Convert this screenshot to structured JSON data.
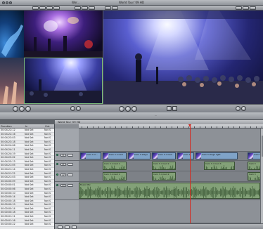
{
  "viewer": {
    "title": "Wor..."
  },
  "canvas": {
    "title": "World Tour '09 HD",
    "status": "..."
  },
  "timeline": {
    "tab_label": "World Tour '09 HD"
  },
  "browser": {
    "columns": [
      "Duration",
      "In",
      "Out"
    ],
    "rows": [
      {
        "duration": "00:04:22:12",
        "in": "Not Set",
        "out": "Not S"
      },
      {
        "duration": "00:04:22:16",
        "in": "Not Set",
        "out": "Not S"
      },
      {
        "duration": "00:04:23:03",
        "in": "Not Set",
        "out": "Not S"
      },
      {
        "duration": "00:04:23:18",
        "in": "Not Set",
        "out": "Not S"
      },
      {
        "duration": "00:04:24:06",
        "in": "Not Set",
        "out": "Not S"
      },
      {
        "duration": "00:04:24:11",
        "in": "Not Set",
        "out": "Not S"
      },
      {
        "duration": "00:04:24:19",
        "in": "Not Set",
        "out": "Not S"
      },
      {
        "duration": "00:04:25:02",
        "in": "Not Set",
        "out": "Not S"
      },
      {
        "duration": "00:04:25:13",
        "in": "Not Set",
        "out": "Not S"
      },
      {
        "duration": "00:04:21:05",
        "in": "Not Set",
        "out": "Not S"
      },
      {
        "duration": "00:04:21:14",
        "in": "Not Set",
        "out": "Not S"
      },
      {
        "duration": "00:04:21:22",
        "in": "Not Set",
        "out": "Not S"
      },
      {
        "duration": "00:04:21:03",
        "in": "Not Set",
        "out": "Not S"
      },
      {
        "duration": "00:04:00:09",
        "in": "Not Set",
        "out": "Not S"
      },
      {
        "duration": "00:00:00:01",
        "in": "Not Set",
        "out": "Not S"
      },
      {
        "duration": "00:00:00:06",
        "in": "Not Set",
        "out": "Not S"
      },
      {
        "duration": "00:00:00:10",
        "in": "Not Set",
        "out": "Not S"
      },
      {
        "duration": "00:00:00:14",
        "in": "Not Set",
        "out": "Not S"
      },
      {
        "duration": "00:00:00:18",
        "in": "Not Set",
        "out": "Not S"
      },
      {
        "duration": "00:00:00:19",
        "in": "Not Set",
        "out": "Not S"
      },
      {
        "duration": "00:00:00:14",
        "in": "Not Set",
        "out": "Not S"
      },
      {
        "duration": "00:00:00:18",
        "in": "Not Set",
        "out": "Not S"
      },
      {
        "duration": "00:00:01:11",
        "in": "Not Set",
        "out": "Not S"
      },
      {
        "duration": "00:00:01:16",
        "in": "Not Set",
        "out": "Not S"
      },
      {
        "duration": "00:00:00:22",
        "in": "Not Set",
        "out": "Not S"
      }
    ]
  },
  "tracks": {
    "video": {
      "clips": [
        "Cam 3 cl...",
        "Cam 3 crowd",
        "Cam 3 stage",
        "Cam 3 crowd",
        "Cam 2",
        "Cam 3 stage light",
        "Cam 3"
      ]
    },
    "audio_top": {
      "label": "A1",
      "clips": [
        "Cam 3 crowd 1",
        "Cam 3 crowd 2",
        "Cam 3 crowd 3",
        "Cam 3"
      ]
    },
    "audio_mid": {
      "label": "A2",
      "clips": [
        "Cam 3 crowd 1",
        "Cam 3 crowd 2",
        "Cam 3"
      ]
    },
    "audio_music": {
      "label": "A3",
      "clips": [
        "Music Mix"
      ]
    },
    "v_label": "V1"
  },
  "colors": {
    "playhead": "#d52a1f",
    "video_clip": "#7fa3c8",
    "audio_clip": "#83a178"
  },
  "icons": [
    "play-icon",
    "rewind-icon",
    "forward-icon",
    "zoom-icon",
    "razor-icon"
  ]
}
